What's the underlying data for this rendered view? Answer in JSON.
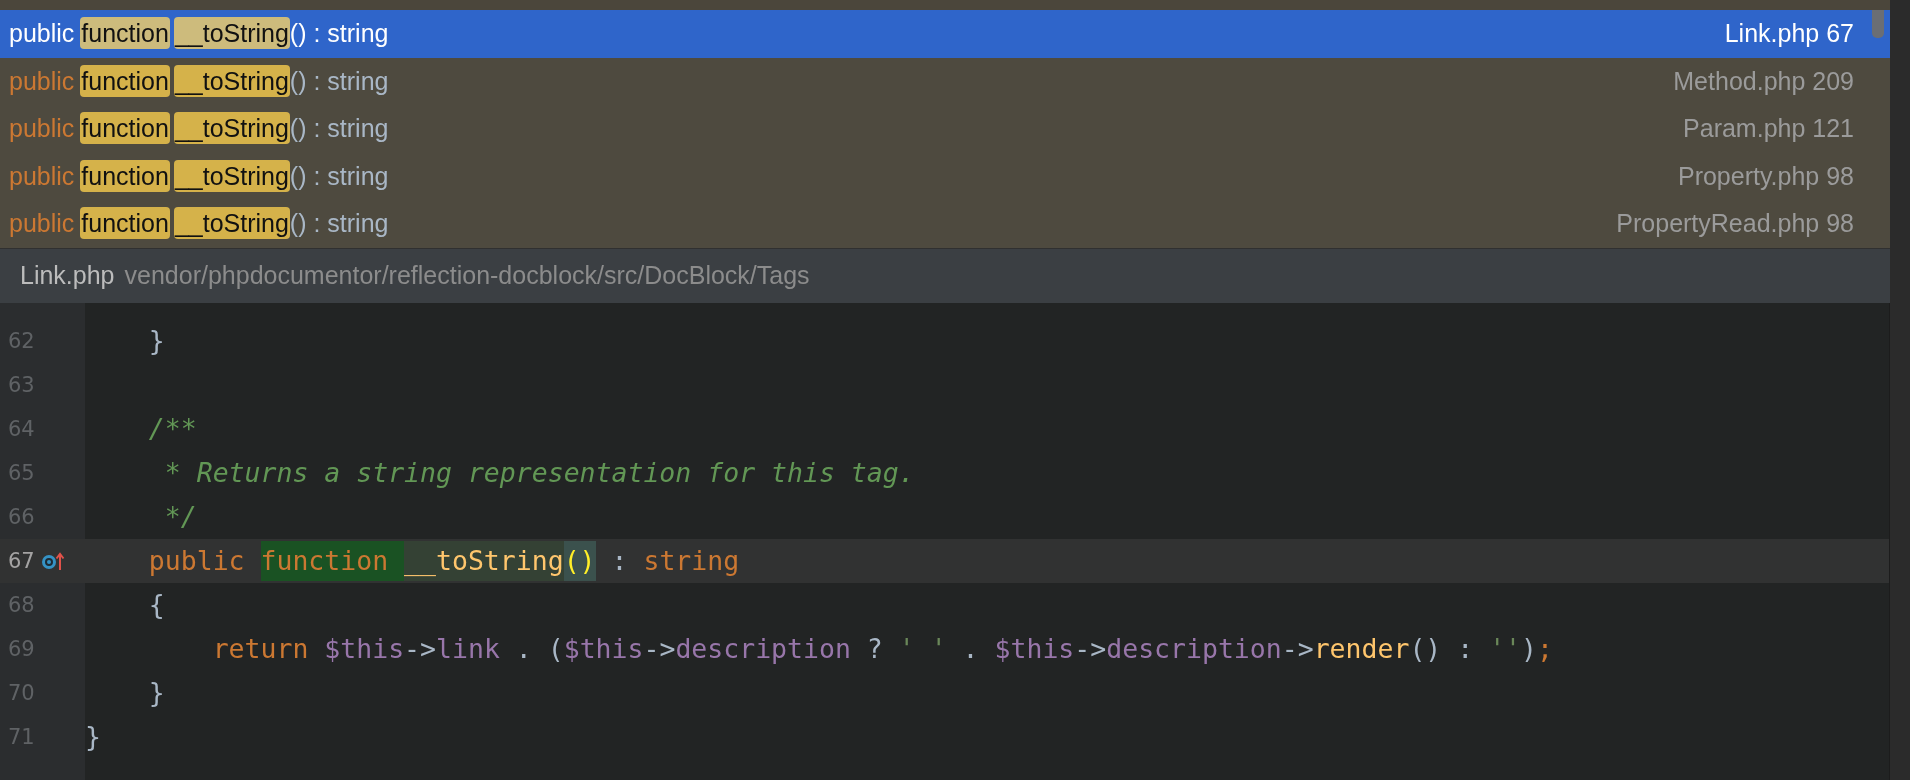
{
  "results": [
    {
      "signature": [
        {
          "text": "public",
          "kind": "keyword"
        },
        {
          "text": "function",
          "kind": "match"
        },
        {
          "text": "__toString",
          "kind": "match"
        },
        {
          "text": "() : string",
          "kind": "plain"
        }
      ],
      "location": "Link.php 67",
      "selected": true
    },
    {
      "signature": [
        {
          "text": "public",
          "kind": "keyword"
        },
        {
          "text": "function",
          "kind": "match"
        },
        {
          "text": "__toString",
          "kind": "match"
        },
        {
          "text": "() : string",
          "kind": "plain"
        }
      ],
      "location": "Method.php 209",
      "selected": false
    },
    {
      "signature": [
        {
          "text": "public",
          "kind": "keyword"
        },
        {
          "text": "function",
          "kind": "match"
        },
        {
          "text": "__toString",
          "kind": "match"
        },
        {
          "text": "() : string",
          "kind": "plain"
        }
      ],
      "location": "Param.php 121",
      "selected": false
    },
    {
      "signature": [
        {
          "text": "public",
          "kind": "keyword"
        },
        {
          "text": "function",
          "kind": "match"
        },
        {
          "text": "__toString",
          "kind": "match"
        },
        {
          "text": "() : string",
          "kind": "plain"
        }
      ],
      "location": "Property.php 98",
      "selected": false
    },
    {
      "signature": [
        {
          "text": "public",
          "kind": "keyword"
        },
        {
          "text": "function",
          "kind": "match"
        },
        {
          "text": "__toString",
          "kind": "match"
        },
        {
          "text": "() : string",
          "kind": "plain"
        }
      ],
      "location": "PropertyRead.php 98",
      "selected": false
    }
  ],
  "preview": {
    "file": "Link.php",
    "path": "vendor/phpdocumentor/reflection-docblock/src/DocBlock/Tags"
  },
  "editor": {
    "lines": [
      {
        "number": "62",
        "current": false,
        "tokens": [
          {
            "text": "    }",
            "kind": "plain"
          }
        ]
      },
      {
        "number": "63",
        "current": false
      },
      {
        "number": "64",
        "current": false,
        "tokens": [
          {
            "text": "    /**",
            "kind": "comment"
          }
        ]
      },
      {
        "number": "65",
        "current": false,
        "tokens": [
          {
            "text": "     * Returns a string representation for this tag.",
            "kind": "comment"
          }
        ]
      },
      {
        "number": "66",
        "current": false,
        "tokens": [
          {
            "text": "     */",
            "kind": "comment"
          }
        ]
      },
      {
        "number": "67",
        "current": true,
        "gutter_icon": true,
        "tokens": [
          {
            "text": "    public ",
            "kind": "keyword"
          },
          {
            "text": "function ",
            "kind": "keyword",
            "highlighted": true
          },
          {
            "text": "__toString",
            "kind": "method",
            "highlighted": true
          },
          {
            "text": "()",
            "kind": "brace",
            "highlighted": true
          },
          {
            "text": " : ",
            "kind": "plain"
          },
          {
            "text": "string",
            "kind": "keyword"
          }
        ]
      },
      {
        "number": "68",
        "current": false,
        "tokens": [
          {
            "text": "    {",
            "kind": "plain"
          }
        ]
      },
      {
        "number": "69",
        "current": false,
        "tokens": [
          {
            "text": "        return ",
            "kind": "keyword"
          },
          {
            "text": "$this",
            "kind": "var"
          },
          {
            "text": "->",
            "kind": "plain"
          },
          {
            "text": "link",
            "kind": "field"
          },
          {
            "text": " . (",
            "kind": "plain"
          },
          {
            "text": "$this",
            "kind": "var"
          },
          {
            "text": "->",
            "kind": "plain"
          },
          {
            "text": "description",
            "kind": "field"
          },
          {
            "text": " ? ",
            "kind": "plain"
          },
          {
            "text": "' '",
            "kind": "string"
          },
          {
            "text": " . ",
            "kind": "plain"
          },
          {
            "text": "$this",
            "kind": "var"
          },
          {
            "text": "->",
            "kind": "plain"
          },
          {
            "text": "description",
            "kind": "field"
          },
          {
            "text": "->",
            "kind": "plain"
          },
          {
            "text": "render",
            "kind": "method"
          },
          {
            "text": "() : ",
            "kind": "plain"
          },
          {
            "text": "''",
            "kind": "string"
          },
          {
            "text": ")",
            "kind": "plain"
          },
          {
            "text": ";",
            "kind": "keyword"
          }
        ]
      },
      {
        "number": "70",
        "current": false,
        "tokens": [
          {
            "text": "    }",
            "kind": "plain"
          }
        ]
      },
      {
        "number": "71",
        "current": false,
        "tokens": [
          {
            "text": "}",
            "kind": "plain"
          }
        ]
      }
    ]
  }
}
